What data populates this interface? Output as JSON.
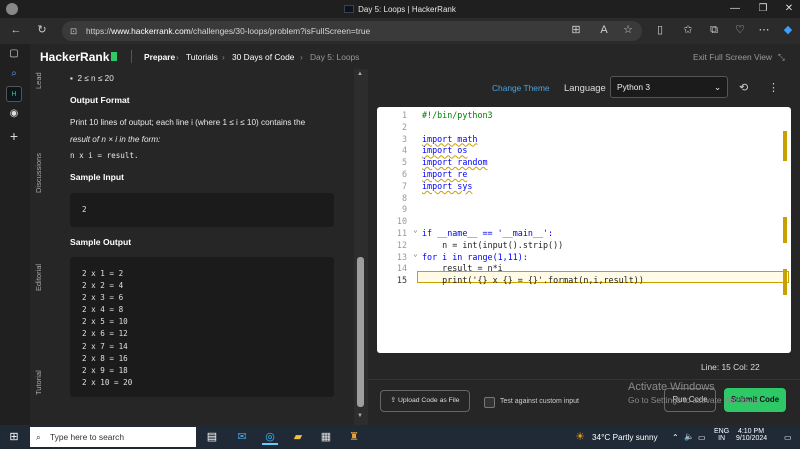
{
  "window": {
    "title": "Day 5: Loops | HackerRank"
  },
  "browser": {
    "url_prefix": "https://",
    "url_host": "www.hackerrank.com",
    "url_path": "/challenges/30-loops/problem?isFullScreen=true"
  },
  "header": {
    "logo": "HackerRank",
    "breadcrumbs": [
      "Prepare",
      "Tutorials",
      "30 Days of Code",
      "Day 5: Loops"
    ],
    "exit_fullscreen": "Exit Full Screen View"
  },
  "vertical_tabs": [
    "Lead",
    "Discussions",
    "Editorial",
    "Tutorial"
  ],
  "problem": {
    "constraint": "2 ≤ n ≤ 20",
    "output_format_title": "Output Format",
    "output_format_line1": "Print 10 lines of output; each line i (where 1 ≤ i ≤ 10) contains the",
    "output_format_line2": "result of n × i in the form:",
    "output_format_line3": "n x i = result.",
    "sample_input_title": "Sample Input",
    "sample_input": "2",
    "sample_output_title": "Sample Output",
    "sample_output": [
      "2 x 1 = 2",
      "2 x 2 = 4",
      "2 x 3 = 6",
      "2 x 4 = 8",
      "2 x 5 = 10",
      "2 x 6 = 12",
      "2 x 7 = 14",
      "2 x 8 = 16",
      "2 x 9 = 18",
      "2 x 10 = 20"
    ]
  },
  "editor": {
    "change_theme": "Change Theme",
    "language_label": "Language",
    "language_value": "Python 3",
    "lines": [
      "#!/bin/python3",
      "",
      "import math",
      "import os",
      "import random",
      "import re",
      "import sys",
      "",
      "",
      "",
      "if __name__ == '__main__':",
      "    n = int(input().strip())",
      "for i in range(1,11):",
      "    result = n*i",
      "    print('{} x {} = {}'.format(n,i,result))"
    ],
    "line_numbers": [
      "1",
      "2",
      "3",
      "4",
      "5",
      "6",
      "7",
      "8",
      "9",
      "10",
      "11",
      "12",
      "13",
      "14",
      "15"
    ],
    "status": "Line: 15 Col: 22",
    "upload_label": "Upload Code as File",
    "custom_input_label": "Test against custom input",
    "run_label": "Run Code",
    "submit_label": "Submit Code"
  },
  "watermark": {
    "line1": "Activate Windows",
    "line2": "Go to Settings to activate Windows."
  },
  "taskbar": {
    "search_placeholder": "Type here to search",
    "weather": "34°C  Partly sunny",
    "lang1": "ENG",
    "lang2": "IN",
    "time": "4:10 PM",
    "date": "9/10/2024"
  },
  "colors": {
    "accent_green": "#2ec866",
    "link_blue": "#4aa3df",
    "bg_dark": "#262626"
  }
}
